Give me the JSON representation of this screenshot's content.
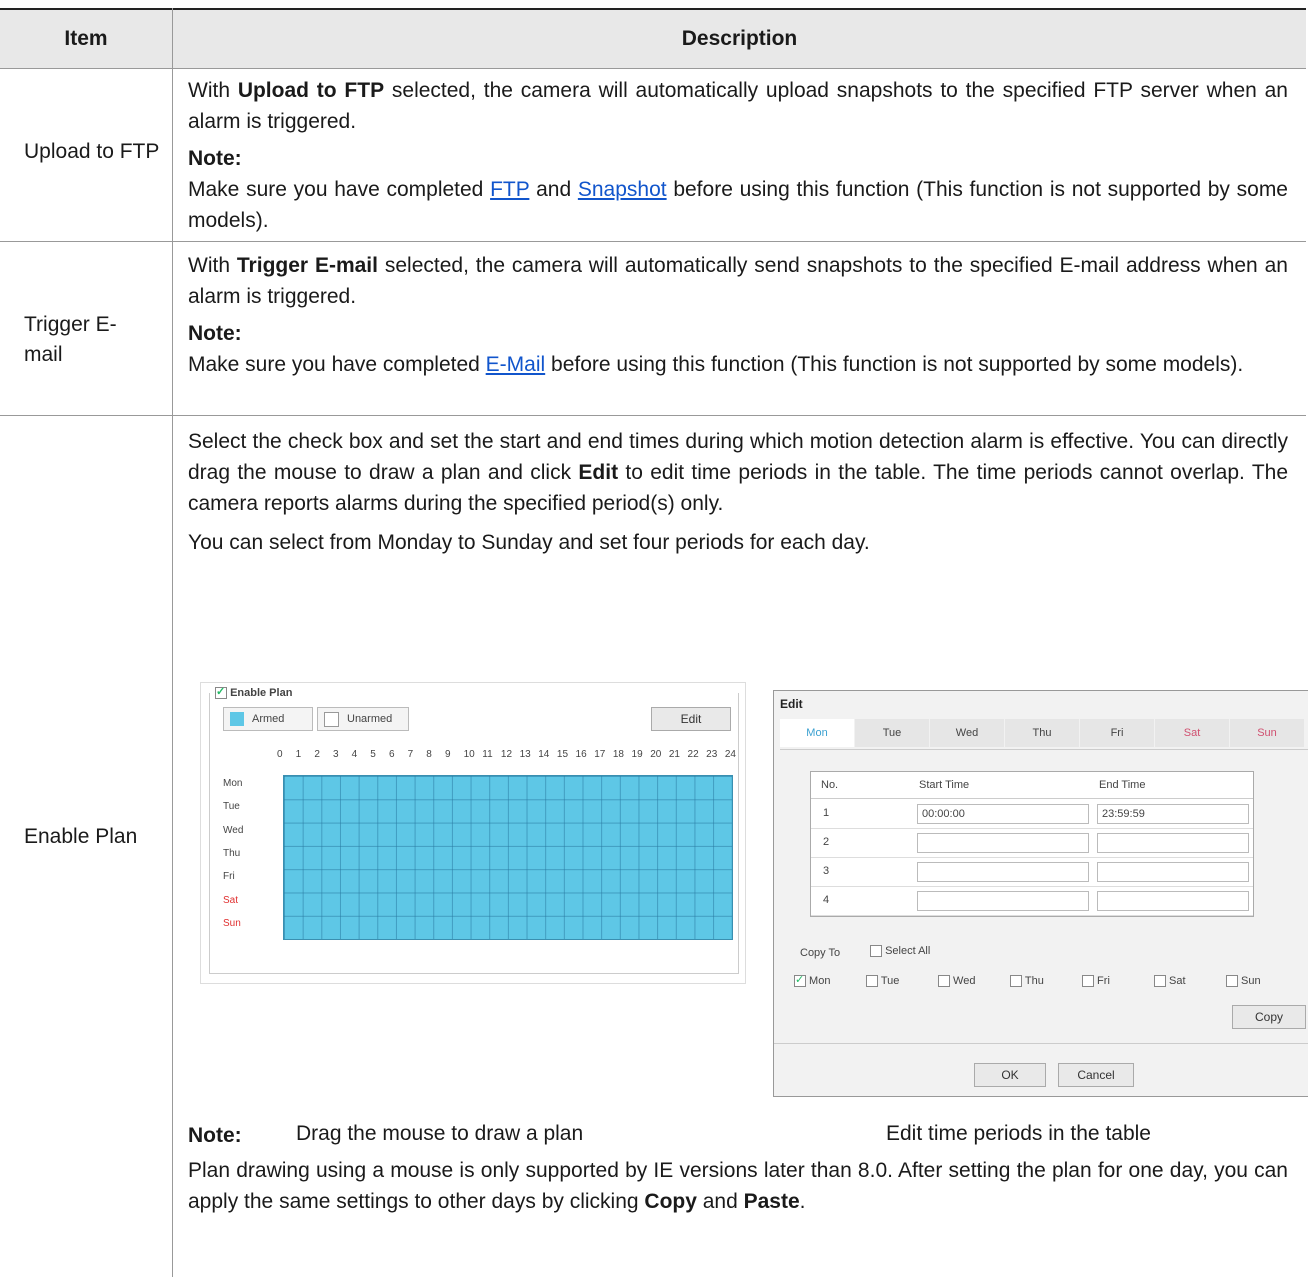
{
  "header": {
    "item": "Item",
    "description": "Description"
  },
  "rows": {
    "ftp": {
      "item": "Upload to FTP",
      "p1a": "With ",
      "p1b": "Upload to FTP",
      "p1c": " selected, the camera will automatically upload snapshots to the specified FTP server when an alarm is triggered.",
      "note": "Note:",
      "n1": "Make sure you have completed ",
      "link1": "FTP",
      "n2": " and ",
      "link2": "Snapshot",
      "n3": " before using this function (This function is not supported by some models)."
    },
    "email": {
      "item": "Trigger E-mail",
      "p1a": "With ",
      "p1b": "Trigger E-mail",
      "p1c": " selected, the camera will automatically send snapshots to the specified E-mail address when an alarm is triggered.",
      "note": "Note:",
      "n1": "Make sure you have completed ",
      "link1": "E-Mail",
      "n2": " before using this function (This function is not supported by some models)."
    },
    "plan": {
      "item": "Enable Plan",
      "p1a": "Select the check box and set the start and end times during which motion detection alarm is effective. You can directly drag the mouse to draw a plan and click ",
      "p1b": "Edit",
      "p1c": " to edit time periods in the table. The time periods cannot overlap. The camera reports alarms during the specified period(s) only.",
      "p2": "You can select from Monday to Sunday and set four periods for each day.",
      "cap1": "Drag the mouse to draw a plan",
      "cap2": "Edit time periods in the table",
      "note": "Note:",
      "n1": "Plan drawing using a mouse is only supported by IE versions later than 8.0. After setting the plan for one day, you can apply the same settings to other days by clicking ",
      "n_copy": "Copy",
      "n2": " and ",
      "n_paste": "Paste",
      "n3": "."
    }
  },
  "plan_ui": {
    "enable": "Enable Plan",
    "armed": "Armed",
    "unarmed": "Unarmed",
    "edit": "Edit",
    "hours": [
      "0",
      "1",
      "2",
      "3",
      "4",
      "5",
      "6",
      "7",
      "8",
      "9",
      "10",
      "11",
      "12",
      "13",
      "14",
      "15",
      "16",
      "17",
      "18",
      "19",
      "20",
      "21",
      "22",
      "23",
      "24"
    ],
    "days": [
      "Mon",
      "Tue",
      "Wed",
      "Thu",
      "Fri",
      "Sat",
      "Sun"
    ],
    "armed_color": "#5ec7e6",
    "weekend_color": "#e03030"
  },
  "edit_ui": {
    "title": "Edit",
    "tabs": [
      "Mon",
      "Tue",
      "Wed",
      "Thu",
      "Fri",
      "Sat",
      "Sun"
    ],
    "col_no": "No.",
    "col_start": "Start Time",
    "col_end": "End Time",
    "rows": [
      {
        "no": "1",
        "start": "00:00:00",
        "end": "23:59:59"
      },
      {
        "no": "2",
        "start": "",
        "end": ""
      },
      {
        "no": "3",
        "start": "",
        "end": ""
      },
      {
        "no": "4",
        "start": "",
        "end": ""
      }
    ],
    "copy_to": "Copy To",
    "select_all": "Select All",
    "copy_days": [
      "Mon",
      "Tue",
      "Wed",
      "Thu",
      "Fri",
      "Sat",
      "Sun"
    ],
    "copy": "Copy",
    "ok": "OK",
    "cancel": "Cancel"
  }
}
